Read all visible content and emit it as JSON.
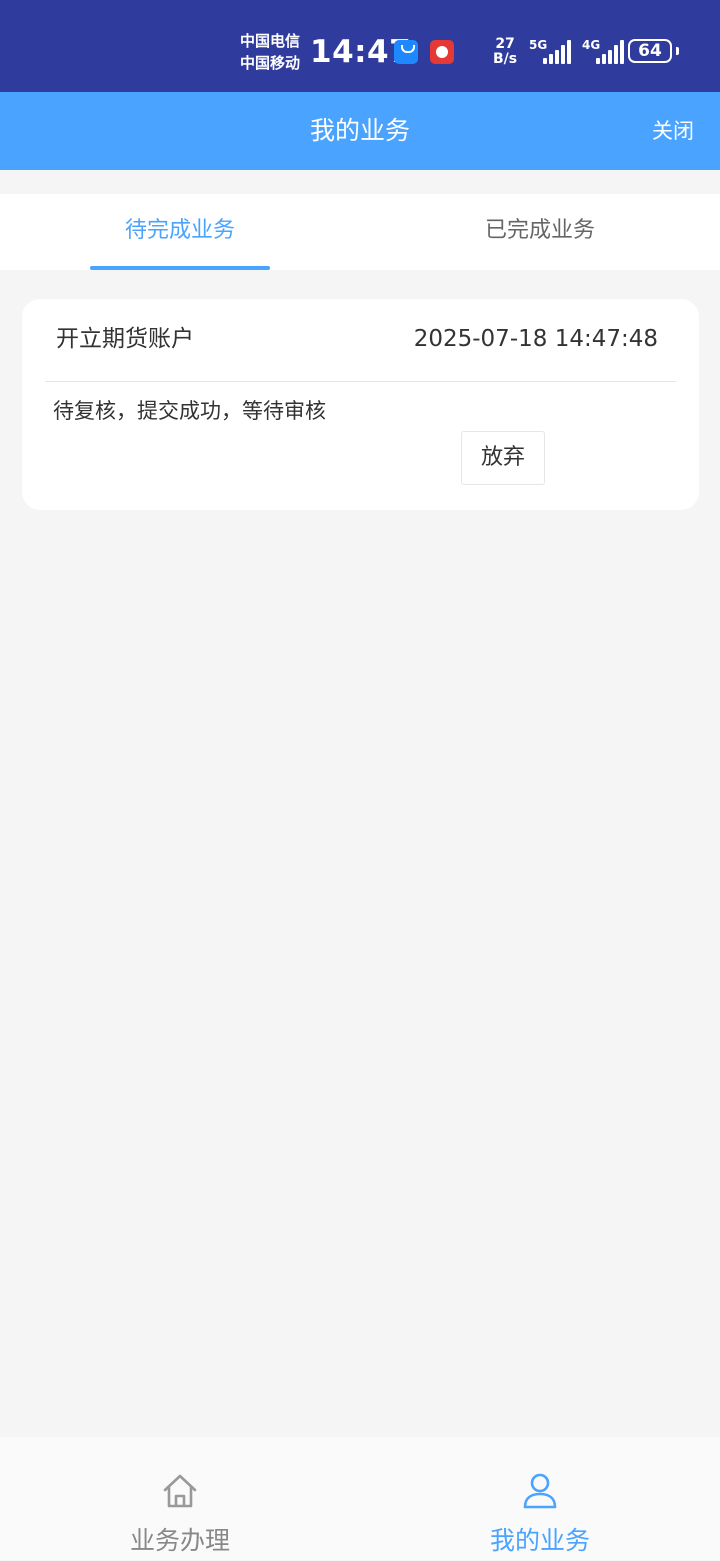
{
  "status_bar": {
    "carrier_1": "中国电信",
    "carrier_2": "中国移动",
    "time": "14:47",
    "net_speed_value": "27",
    "net_speed_unit": "B/s",
    "signal_1_label": "5G",
    "signal_2_label": "4G",
    "battery": "64",
    "icons": [
      "app-store-icon",
      "news-app-icon",
      "signal-icon",
      "battery-icon"
    ]
  },
  "header": {
    "title": "我的业务",
    "close_label": "关闭"
  },
  "tabs": {
    "pending_label": "待完成业务",
    "completed_label": "已完成业务",
    "active": "pending"
  },
  "business_card": {
    "title": "开立期货账户",
    "timestamp": "2025-07-18 14:47:48",
    "status": "待复核，提交成功，等待审核",
    "abandon_label": "放弃"
  },
  "bottom_nav": {
    "home_label": "业务办理",
    "mine_label": "我的业务",
    "home_icon": "house-icon",
    "mine_icon": "user-icon",
    "active": "mine"
  },
  "colors": {
    "status_bar_bg": "#2f3c9e",
    "header_bg": "#4aa3ff",
    "accent": "#4aa3ff",
    "page_bg": "#f5f5f5"
  }
}
